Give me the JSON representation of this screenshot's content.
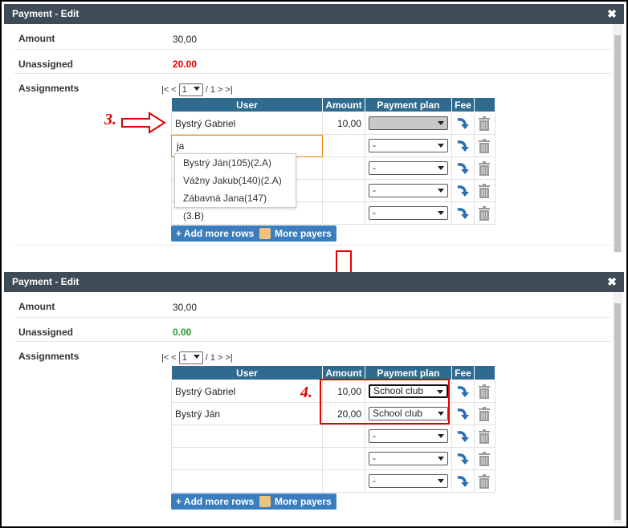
{
  "colors": {
    "header_bg": "#3f4b57",
    "grid_header_bg": "#2f6a8f",
    "button_bg": "#3a7ebf",
    "unassigned_red": "#e00000",
    "unassigned_green": "#2a9a2a",
    "annotation_red": "#e00000"
  },
  "icons": {
    "close": "close-icon",
    "fee": "curved-arrow-icon",
    "delete": "trash-icon",
    "person": "person-icon"
  },
  "dialog1": {
    "title": "Payment - Edit",
    "close": "✖",
    "amount_label": "Amount",
    "amount_value": "30,00",
    "unassigned_label": "Unassigned",
    "unassigned_value": "20.00",
    "assignments_label": "Assignments",
    "pager": {
      "first": "|<",
      "prev": "<",
      "page": "1",
      "of": "/ 1",
      "next": ">",
      "last": ">|"
    },
    "columns": [
      "User",
      "Amount",
      "Payment plan",
      "Fee"
    ],
    "rows": [
      {
        "user": "Bystrý Gabriel",
        "amount": "10,00",
        "plan": ""
      },
      {
        "user": "ja",
        "amount": "",
        "plan": "-"
      },
      {
        "user": "",
        "amount": "",
        "plan": "-"
      },
      {
        "user": "",
        "amount": "",
        "plan": "-"
      },
      {
        "user": "",
        "amount": "",
        "plan": "-"
      }
    ],
    "autocomplete": [
      "Bystrý Ján(105)(2.A)",
      "Vážny Jakub(140)(2.A)",
      "Zábavná Jana(147)(3.B)"
    ],
    "add_rows": "+ Add more rows",
    "more_payers": "More payers",
    "step": "3."
  },
  "dialog2": {
    "title": "Payment - Edit",
    "close": "✖",
    "amount_label": "Amount",
    "amount_value": "30,00",
    "unassigned_label": "Unassigned",
    "unassigned_value": "0.00",
    "assignments_label": "Assignments",
    "pager": {
      "first": "|<",
      "prev": "<",
      "page": "1",
      "of": "/ 1",
      "next": ">",
      "last": ">|"
    },
    "columns": [
      "User",
      "Amount",
      "Payment plan",
      "Fee"
    ],
    "rows": [
      {
        "user": "Bystrý Gabriel",
        "amount": "10,00",
        "plan": "School club"
      },
      {
        "user": "Bystrý Ján",
        "amount": "20,00",
        "plan": "School club"
      },
      {
        "user": "",
        "amount": "",
        "plan": "-"
      },
      {
        "user": "",
        "amount": "",
        "plan": "-"
      },
      {
        "user": "",
        "amount": "",
        "plan": "-"
      }
    ],
    "add_rows": "+ Add more rows",
    "more_payers": "More payers",
    "step": "4."
  }
}
